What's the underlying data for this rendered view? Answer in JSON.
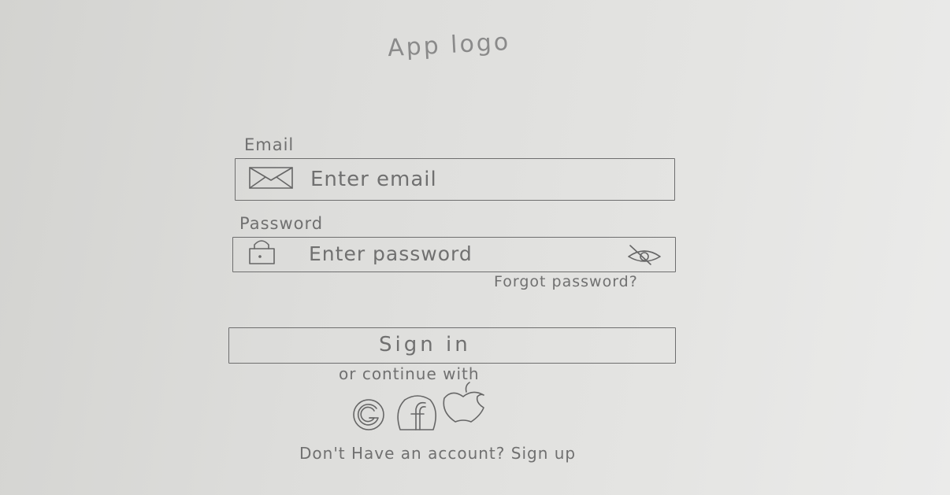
{
  "app_logo": "App logo",
  "email": {
    "label": "Email",
    "placeholder": "Enter email",
    "icon": "envelope-icon"
  },
  "password": {
    "label": "Password",
    "placeholder": "Enter password",
    "icon": "lock-icon",
    "toggle_icon": "eye-slash-icon"
  },
  "forgot_password": "Forgot password?",
  "sign_in": "Sign in",
  "continue_with": "or continue with",
  "social": [
    {
      "name": "Google",
      "icon": "google-icon"
    },
    {
      "name": "Facebook",
      "icon": "facebook-icon"
    },
    {
      "name": "Apple",
      "icon": "apple-icon"
    }
  ],
  "signup": {
    "prompt": "Don't Have an account?",
    "link": "Sign up"
  },
  "colors": {
    "pencil": "#6c6c6c",
    "paper": "#e0e0de"
  }
}
